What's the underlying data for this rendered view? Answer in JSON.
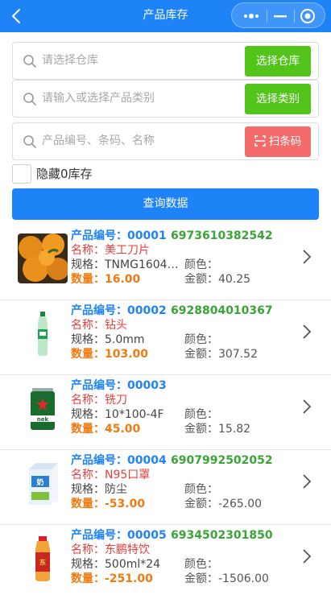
{
  "header": {
    "title": "产品库存"
  },
  "filters": {
    "warehouse_placeholder": "请选择仓库",
    "warehouse_button": "选择仓库",
    "category_placeholder": "请输入或选择产品类别",
    "category_button": "选择类别",
    "keyword_placeholder": "产品编号、条码、名称",
    "scan_button": "扫条码",
    "hide_zero_label": "隐藏0库存",
    "query_button": "查询数据"
  },
  "labels": {
    "code": "产品编号：",
    "name": "名称：",
    "spec": "规格：",
    "color": "颜色：",
    "qty": "数量：",
    "amount": "金额："
  },
  "colors": {
    "primary": "#1e83f7",
    "green_button": "#52c41a",
    "scan_button": "#f36b6b",
    "name_text": "#ea3d3d",
    "barcode_text": "#3aa536",
    "qty_text": "#f07a10"
  },
  "products": [
    {
      "code": "00001",
      "barcode": "6973610382542",
      "name": "美工刀片",
      "spec": "TNMG16040...",
      "color": "",
      "qty": "16.00",
      "amount": "40.25",
      "image": "orange-fruit-image"
    },
    {
      "code": "00002",
      "barcode": "6928804010367",
      "name": "钻头",
      "spec": "5.0mm",
      "color": "",
      "qty": "103.00",
      "amount": "307.52",
      "image": "green-soda-bottle-image"
    },
    {
      "code": "00003",
      "barcode": "",
      "name": "铣刀",
      "spec": "10*100-4F",
      "color": "",
      "qty": "45.00",
      "amount": "15.82",
      "image": "beer-can-image"
    },
    {
      "code": "00004",
      "barcode": "6907992502052",
      "name": "N95口罩",
      "spec": "防尘",
      "color": "",
      "qty": "-53.00",
      "amount": "-265.00",
      "image": "milk-carton-image"
    },
    {
      "code": "00005",
      "barcode": "6934502301850",
      "name": "东鹏特饮",
      "spec": "500ml*24",
      "color": "",
      "qty": "-251.00",
      "amount": "-1506.00",
      "image": "energy-drink-bottle-image"
    }
  ]
}
